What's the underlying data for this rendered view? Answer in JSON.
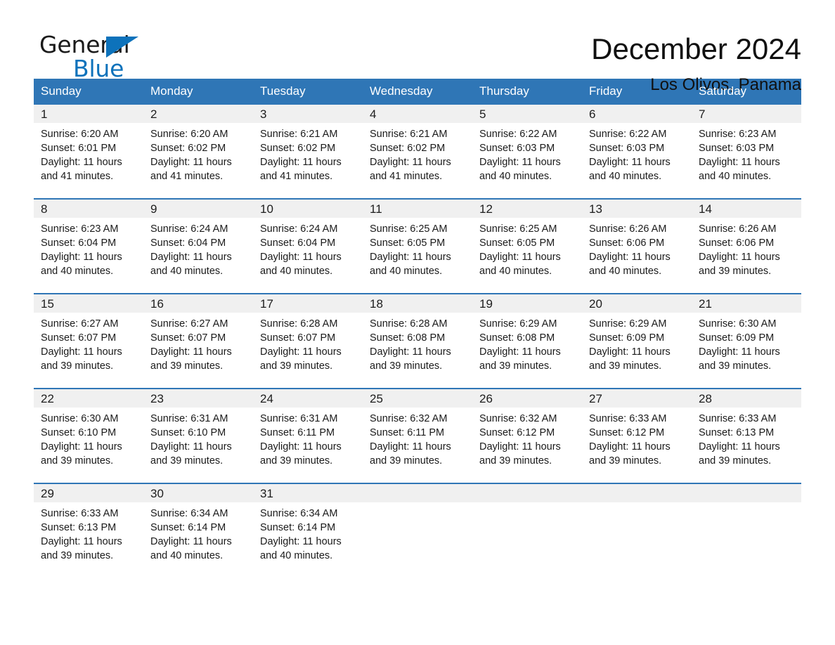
{
  "brand": {
    "name_part1": "General",
    "name_part2": "Blue",
    "triangle_icon": "triangle-icon",
    "color_black": "#1a1a1a",
    "color_blue": "#0d72bb"
  },
  "header": {
    "title": "December 2024",
    "subtitle": "Los Olivos, Panama"
  },
  "theme": {
    "header_blue": "#2f76b6",
    "row_divider_blue": "#2f76b6",
    "date_band_gray": "#f0f0f0",
    "text_black": "#1a1a1a"
  },
  "calendar": {
    "weekdays": [
      "Sunday",
      "Monday",
      "Tuesday",
      "Wednesday",
      "Thursday",
      "Friday",
      "Saturday"
    ],
    "weeks": [
      [
        {
          "day": "1",
          "sunrise": "Sunrise: 6:20 AM",
          "sunset": "Sunset: 6:01 PM",
          "daylight1": "Daylight: 11 hours",
          "daylight2": "and 41 minutes."
        },
        {
          "day": "2",
          "sunrise": "Sunrise: 6:20 AM",
          "sunset": "Sunset: 6:02 PM",
          "daylight1": "Daylight: 11 hours",
          "daylight2": "and 41 minutes."
        },
        {
          "day": "3",
          "sunrise": "Sunrise: 6:21 AM",
          "sunset": "Sunset: 6:02 PM",
          "daylight1": "Daylight: 11 hours",
          "daylight2": "and 41 minutes."
        },
        {
          "day": "4",
          "sunrise": "Sunrise: 6:21 AM",
          "sunset": "Sunset: 6:02 PM",
          "daylight1": "Daylight: 11 hours",
          "daylight2": "and 41 minutes."
        },
        {
          "day": "5",
          "sunrise": "Sunrise: 6:22 AM",
          "sunset": "Sunset: 6:03 PM",
          "daylight1": "Daylight: 11 hours",
          "daylight2": "and 40 minutes."
        },
        {
          "day": "6",
          "sunrise": "Sunrise: 6:22 AM",
          "sunset": "Sunset: 6:03 PM",
          "daylight1": "Daylight: 11 hours",
          "daylight2": "and 40 minutes."
        },
        {
          "day": "7",
          "sunrise": "Sunrise: 6:23 AM",
          "sunset": "Sunset: 6:03 PM",
          "daylight1": "Daylight: 11 hours",
          "daylight2": "and 40 minutes."
        }
      ],
      [
        {
          "day": "8",
          "sunrise": "Sunrise: 6:23 AM",
          "sunset": "Sunset: 6:04 PM",
          "daylight1": "Daylight: 11 hours",
          "daylight2": "and 40 minutes."
        },
        {
          "day": "9",
          "sunrise": "Sunrise: 6:24 AM",
          "sunset": "Sunset: 6:04 PM",
          "daylight1": "Daylight: 11 hours",
          "daylight2": "and 40 minutes."
        },
        {
          "day": "10",
          "sunrise": "Sunrise: 6:24 AM",
          "sunset": "Sunset: 6:04 PM",
          "daylight1": "Daylight: 11 hours",
          "daylight2": "and 40 minutes."
        },
        {
          "day": "11",
          "sunrise": "Sunrise: 6:25 AM",
          "sunset": "Sunset: 6:05 PM",
          "daylight1": "Daylight: 11 hours",
          "daylight2": "and 40 minutes."
        },
        {
          "day": "12",
          "sunrise": "Sunrise: 6:25 AM",
          "sunset": "Sunset: 6:05 PM",
          "daylight1": "Daylight: 11 hours",
          "daylight2": "and 40 minutes."
        },
        {
          "day": "13",
          "sunrise": "Sunrise: 6:26 AM",
          "sunset": "Sunset: 6:06 PM",
          "daylight1": "Daylight: 11 hours",
          "daylight2": "and 40 minutes."
        },
        {
          "day": "14",
          "sunrise": "Sunrise: 6:26 AM",
          "sunset": "Sunset: 6:06 PM",
          "daylight1": "Daylight: 11 hours",
          "daylight2": "and 39 minutes."
        }
      ],
      [
        {
          "day": "15",
          "sunrise": "Sunrise: 6:27 AM",
          "sunset": "Sunset: 6:07 PM",
          "daylight1": "Daylight: 11 hours",
          "daylight2": "and 39 minutes."
        },
        {
          "day": "16",
          "sunrise": "Sunrise: 6:27 AM",
          "sunset": "Sunset: 6:07 PM",
          "daylight1": "Daylight: 11 hours",
          "daylight2": "and 39 minutes."
        },
        {
          "day": "17",
          "sunrise": "Sunrise: 6:28 AM",
          "sunset": "Sunset: 6:07 PM",
          "daylight1": "Daylight: 11 hours",
          "daylight2": "and 39 minutes."
        },
        {
          "day": "18",
          "sunrise": "Sunrise: 6:28 AM",
          "sunset": "Sunset: 6:08 PM",
          "daylight1": "Daylight: 11 hours",
          "daylight2": "and 39 minutes."
        },
        {
          "day": "19",
          "sunrise": "Sunrise: 6:29 AM",
          "sunset": "Sunset: 6:08 PM",
          "daylight1": "Daylight: 11 hours",
          "daylight2": "and 39 minutes."
        },
        {
          "day": "20",
          "sunrise": "Sunrise: 6:29 AM",
          "sunset": "Sunset: 6:09 PM",
          "daylight1": "Daylight: 11 hours",
          "daylight2": "and 39 minutes."
        },
        {
          "day": "21",
          "sunrise": "Sunrise: 6:30 AM",
          "sunset": "Sunset: 6:09 PM",
          "daylight1": "Daylight: 11 hours",
          "daylight2": "and 39 minutes."
        }
      ],
      [
        {
          "day": "22",
          "sunrise": "Sunrise: 6:30 AM",
          "sunset": "Sunset: 6:10 PM",
          "daylight1": "Daylight: 11 hours",
          "daylight2": "and 39 minutes."
        },
        {
          "day": "23",
          "sunrise": "Sunrise: 6:31 AM",
          "sunset": "Sunset: 6:10 PM",
          "daylight1": "Daylight: 11 hours",
          "daylight2": "and 39 minutes."
        },
        {
          "day": "24",
          "sunrise": "Sunrise: 6:31 AM",
          "sunset": "Sunset: 6:11 PM",
          "daylight1": "Daylight: 11 hours",
          "daylight2": "and 39 minutes."
        },
        {
          "day": "25",
          "sunrise": "Sunrise: 6:32 AM",
          "sunset": "Sunset: 6:11 PM",
          "daylight1": "Daylight: 11 hours",
          "daylight2": "and 39 minutes."
        },
        {
          "day": "26",
          "sunrise": "Sunrise: 6:32 AM",
          "sunset": "Sunset: 6:12 PM",
          "daylight1": "Daylight: 11 hours",
          "daylight2": "and 39 minutes."
        },
        {
          "day": "27",
          "sunrise": "Sunrise: 6:33 AM",
          "sunset": "Sunset: 6:12 PM",
          "daylight1": "Daylight: 11 hours",
          "daylight2": "and 39 minutes."
        },
        {
          "day": "28",
          "sunrise": "Sunrise: 6:33 AM",
          "sunset": "Sunset: 6:13 PM",
          "daylight1": "Daylight: 11 hours",
          "daylight2": "and 39 minutes."
        }
      ],
      [
        {
          "day": "29",
          "sunrise": "Sunrise: 6:33 AM",
          "sunset": "Sunset: 6:13 PM",
          "daylight1": "Daylight: 11 hours",
          "daylight2": "and 39 minutes."
        },
        {
          "day": "30",
          "sunrise": "Sunrise: 6:34 AM",
          "sunset": "Sunset: 6:14 PM",
          "daylight1": "Daylight: 11 hours",
          "daylight2": "and 40 minutes."
        },
        {
          "day": "31",
          "sunrise": "Sunrise: 6:34 AM",
          "sunset": "Sunset: 6:14 PM",
          "daylight1": "Daylight: 11 hours",
          "daylight2": "and 40 minutes."
        },
        {
          "day": "",
          "sunrise": "",
          "sunset": "",
          "daylight1": "",
          "daylight2": ""
        },
        {
          "day": "",
          "sunrise": "",
          "sunset": "",
          "daylight1": "",
          "daylight2": ""
        },
        {
          "day": "",
          "sunrise": "",
          "sunset": "",
          "daylight1": "",
          "daylight2": ""
        },
        {
          "day": "",
          "sunrise": "",
          "sunset": "",
          "daylight1": "",
          "daylight2": ""
        }
      ]
    ]
  }
}
